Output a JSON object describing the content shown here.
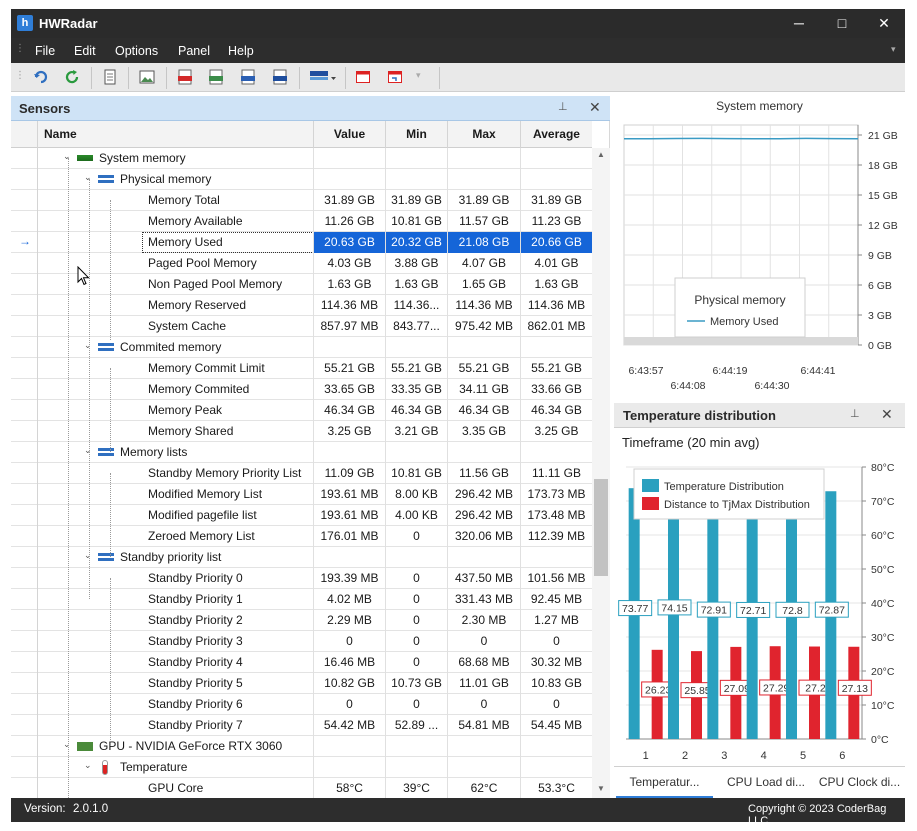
{
  "app": {
    "title": "HWRadar",
    "icon": "hwradar-logo-icon"
  },
  "window_controls": {
    "minimize": "─",
    "maximize": "□",
    "close": "✕"
  },
  "menu": [
    "File",
    "Edit",
    "Options",
    "Panel",
    "Help"
  ],
  "toolbar": {
    "icons": [
      "undo-icon",
      "refresh-icon",
      "document-icon",
      "image-icon",
      "pdf-icon",
      "csv-icon",
      "rtf-icon",
      "docx-icon",
      "color-palette-icon",
      "window-icon",
      "restore-window-icon"
    ]
  },
  "sensors_panel": {
    "title": "Sensors",
    "columns": [
      "Name",
      "Value",
      "Min",
      "Max",
      "Average"
    ],
    "rows": [
      {
        "level": 1,
        "type": "group",
        "icon": "ram-icon",
        "name": "System memory",
        "value": "",
        "min": "",
        "max": "",
        "avg": ""
      },
      {
        "level": 2,
        "type": "group",
        "icon": "category-icon",
        "name": "Physical memory",
        "value": "",
        "min": "",
        "max": "",
        "avg": ""
      },
      {
        "level": 3,
        "type": "item",
        "name": "Memory Total",
        "value": "31.89 GB",
        "min": "31.89 GB",
        "max": "31.89 GB",
        "avg": "31.89 GB"
      },
      {
        "level": 3,
        "type": "item",
        "name": "Memory Available",
        "value": "11.26 GB",
        "min": "10.81 GB",
        "max": "11.57 GB",
        "avg": "11.23 GB"
      },
      {
        "level": 3,
        "type": "item",
        "selected": true,
        "name": "Memory Used",
        "value": "20.63 GB",
        "min": "20.32 GB",
        "max": "21.08 GB",
        "avg": "20.66 GB"
      },
      {
        "level": 3,
        "type": "item",
        "name": "Paged Pool Memory",
        "value": "4.03 GB",
        "min": "3.88 GB",
        "max": "4.07 GB",
        "avg": "4.01 GB"
      },
      {
        "level": 3,
        "type": "item",
        "name": "Non Paged Pool Memory",
        "value": "1.63 GB",
        "min": "1.63 GB",
        "max": "1.65 GB",
        "avg": "1.63 GB"
      },
      {
        "level": 3,
        "type": "item",
        "name": "Memory Reserved",
        "value": "114.36 MB",
        "min": "114.36...",
        "max": "114.36 MB",
        "avg": "114.36 MB"
      },
      {
        "level": 3,
        "type": "item",
        "name": "System Cache",
        "value": "857.97 MB",
        "min": "843.77...",
        "max": "975.42 MB",
        "avg": "862.01 MB"
      },
      {
        "level": 2,
        "type": "group",
        "icon": "category-icon",
        "name": "Commited memory",
        "value": "",
        "min": "",
        "max": "",
        "avg": ""
      },
      {
        "level": 3,
        "type": "item",
        "name": "Memory Commit Limit",
        "value": "55.21 GB",
        "min": "55.21 GB",
        "max": "55.21 GB",
        "avg": "55.21 GB"
      },
      {
        "level": 3,
        "type": "item",
        "name": "Memory Commited",
        "value": "33.65 GB",
        "min": "33.35 GB",
        "max": "34.11 GB",
        "avg": "33.66 GB"
      },
      {
        "level": 3,
        "type": "item",
        "name": "Memory Peak",
        "value": "46.34 GB",
        "min": "46.34 GB",
        "max": "46.34 GB",
        "avg": "46.34 GB"
      },
      {
        "level": 3,
        "type": "item",
        "name": "Memory Shared",
        "value": "3.25 GB",
        "min": "3.21 GB",
        "max": "3.35 GB",
        "avg": "3.25 GB"
      },
      {
        "level": 2,
        "type": "group",
        "icon": "category-icon",
        "name": "Memory lists",
        "value": "",
        "min": "",
        "max": "",
        "avg": ""
      },
      {
        "level": 3,
        "type": "item",
        "name": "Standby Memory Priority List",
        "value": "11.09 GB",
        "min": "10.81 GB",
        "max": "11.56 GB",
        "avg": "11.11 GB"
      },
      {
        "level": 3,
        "type": "item",
        "name": "Modified Memory List",
        "value": "193.61 MB",
        "min": "8.00 KB",
        "max": "296.42 MB",
        "avg": "173.73 MB"
      },
      {
        "level": 3,
        "type": "item",
        "name": "Modified pagefile list",
        "value": "193.61 MB",
        "min": "4.00 KB",
        "max": "296.42 MB",
        "avg": "173.48 MB"
      },
      {
        "level": 3,
        "type": "item",
        "name": "Zeroed Memory List",
        "value": "176.01 MB",
        "min": "0",
        "max": "320.06 MB",
        "avg": "112.39 MB"
      },
      {
        "level": 2,
        "type": "group",
        "icon": "category-icon",
        "name": "Standby priority list",
        "value": "",
        "min": "",
        "max": "",
        "avg": ""
      },
      {
        "level": 3,
        "type": "item",
        "name": "Standby Priority 0",
        "value": "193.39 MB",
        "min": "0",
        "max": "437.50 MB",
        "avg": "101.56 MB"
      },
      {
        "level": 3,
        "type": "item",
        "name": "Standby Priority 1",
        "value": "4.02 MB",
        "min": "0",
        "max": "331.43 MB",
        "avg": "92.45 MB"
      },
      {
        "level": 3,
        "type": "item",
        "name": "Standby Priority 2",
        "value": "2.29 MB",
        "min": "0",
        "max": "2.30 MB",
        "avg": "1.27 MB"
      },
      {
        "level": 3,
        "type": "item",
        "name": "Standby Priority 3",
        "value": "0",
        "min": "0",
        "max": "0",
        "avg": "0"
      },
      {
        "level": 3,
        "type": "item",
        "name": "Standby Priority 4",
        "value": "16.46 MB",
        "min": "0",
        "max": "68.68 MB",
        "avg": "30.32 MB"
      },
      {
        "level": 3,
        "type": "item",
        "name": "Standby Priority 5",
        "value": "10.82 GB",
        "min": "10.73 GB",
        "max": "11.01 GB",
        "avg": "10.83 GB"
      },
      {
        "level": 3,
        "type": "item",
        "name": "Standby Priority 6",
        "value": "0",
        "min": "0",
        "max": "0",
        "avg": "0"
      },
      {
        "level": 3,
        "type": "item",
        "name": "Standby Priority 7",
        "value": "54.42 MB",
        "min": "52.89 ...",
        "max": "54.81 MB",
        "avg": "54.45 MB"
      },
      {
        "level": 1,
        "type": "group",
        "icon": "gpu-icon",
        "name": "GPU - NVIDIA GeForce RTX 3060",
        "value": "",
        "min": "",
        "max": "",
        "avg": ""
      },
      {
        "level": 2,
        "type": "group",
        "icon": "thermometer-icon",
        "name": "Temperature",
        "value": "",
        "min": "",
        "max": "",
        "avg": ""
      },
      {
        "level": 3,
        "type": "item",
        "name": "GPU Core",
        "value": "58°C",
        "min": "39°C",
        "max": "62°C",
        "avg": "53.3°C"
      }
    ]
  },
  "memory_chart": {
    "chart_data": {
      "type": "line",
      "title": "System memory",
      "legend_title": "Physical memory",
      "series": [
        {
          "name": "Memory Used",
          "color": "#3a9bc4",
          "values": [
            20.63,
            20.63,
            20.65,
            20.66,
            20.64,
            20.62,
            20.63,
            20.66,
            20.64,
            20.63
          ]
        }
      ],
      "x_ticks": [
        "6:43:57",
        "6:44:08",
        "6:44:19",
        "6:44:30",
        "6:44:41"
      ],
      "y_ticks": [
        "0 GB",
        "3 GB",
        "6 GB",
        "9 GB",
        "12 GB",
        "15 GB",
        "18 GB",
        "21 GB"
      ],
      "ylim": [
        0,
        22
      ],
      "grid": true,
      "legend_placement": "bottom-center"
    }
  },
  "temp_panel": {
    "title": "Temperature distribution",
    "subtitle": "Timeframe (20 min avg)",
    "tabs": [
      "Temperatur...",
      "CPU Load di...",
      "CPU Clock di..."
    ],
    "chart_data": {
      "type": "bar",
      "categories": [
        "1",
        "2",
        "3",
        "4",
        "5",
        "6"
      ],
      "series": [
        {
          "name": "Temperature Distribution",
          "color": "#2aa0bf",
          "values": [
            73.77,
            74.15,
            72.91,
            72.71,
            72.8,
            72.87
          ]
        },
        {
          "name": "Distance to TjMax Distribution",
          "color": "#e0242e",
          "values": [
            26.23,
            25.85,
            27.09,
            27.29,
            27.2,
            27.13
          ]
        }
      ],
      "y_ticks": [
        "0°C",
        "10°C",
        "20°C",
        "30°C",
        "40°C",
        "50°C",
        "60°C",
        "70°C",
        "80°C"
      ],
      "ylim": [
        0,
        80
      ],
      "grid": true,
      "legend_placement": "top-left"
    }
  },
  "status": {
    "version_label": "Version:",
    "version_value": "2.0.1.0",
    "copyright": "Copyright © 2023 CoderBag LLC"
  }
}
